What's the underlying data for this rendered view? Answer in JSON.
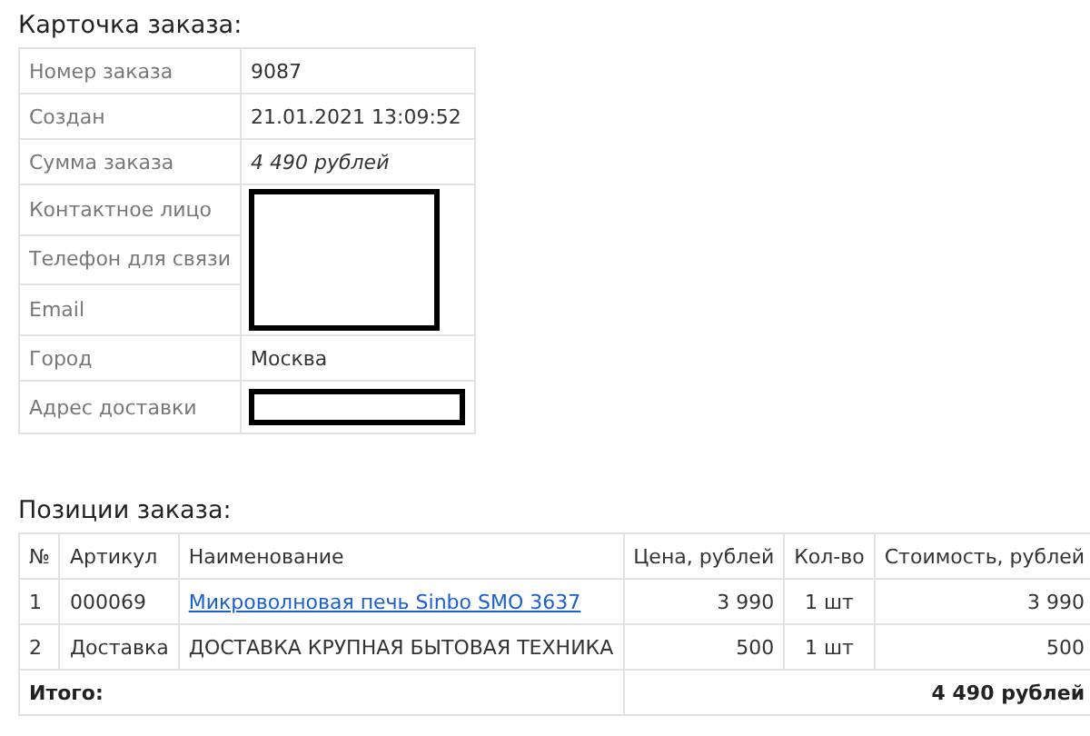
{
  "order_card": {
    "title": "Карточка заказа:",
    "rows": [
      {
        "label": "Номер заказа",
        "kind": "text",
        "value": "9087"
      },
      {
        "label": "Создан",
        "kind": "text",
        "value": "21.01.2021 13:09:52"
      },
      {
        "label": "Сумма заказа",
        "kind": "italic",
        "value": "4 490 рублей"
      },
      {
        "label": "Контактное лицо",
        "kind": "redacted"
      },
      {
        "label": "Телефон для связи",
        "kind": "redacted"
      },
      {
        "label": "Email",
        "kind": "redacted"
      },
      {
        "label": "Город",
        "kind": "text",
        "value": "Москва"
      },
      {
        "label": "Адрес доставки",
        "kind": "redacted"
      }
    ]
  },
  "order_items": {
    "title": "Позиции заказа:",
    "columns": [
      "№",
      "Артикул",
      "Наименование",
      "Цена, рублей",
      "Кол-во",
      "Стоимость, рублей"
    ],
    "rows": [
      {
        "number": "1",
        "sku": "000069",
        "name": "Микроволновая печь Sinbo SMO 3637",
        "kind": "link",
        "price": "3 990",
        "quantity": "1 шт",
        "cost": "3 990"
      },
      {
        "number": "2",
        "sku": "Доставка",
        "name": "ДОСТАВКА КРУПНАЯ БЫТОВАЯ ТЕХНИКА",
        "kind": "text",
        "price": "500",
        "quantity": "1 шт",
        "cost": "500"
      }
    ],
    "total": {
      "label": "Итого:",
      "value": "4 490 рублей"
    }
  }
}
